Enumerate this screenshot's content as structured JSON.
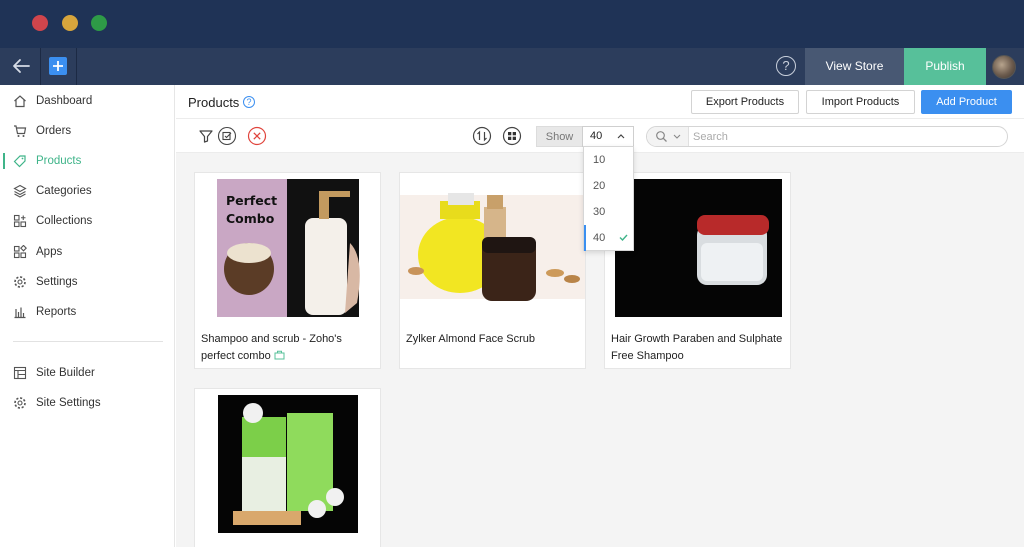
{
  "app": {
    "view_store_label": "View Store",
    "publish_label": "Publish",
    "help_glyph": "?",
    "accent_color": "#3fb489",
    "primary_color": "#3b8ff0"
  },
  "sidebar": {
    "items": [
      {
        "label": "Dashboard",
        "icon": "home-icon"
      },
      {
        "label": "Orders",
        "icon": "cart-icon"
      },
      {
        "label": "Products",
        "icon": "tag-icon",
        "active": true
      },
      {
        "label": "Categories",
        "icon": "layers-icon"
      },
      {
        "label": "Collections",
        "icon": "grid-plus-icon"
      },
      {
        "label": "Apps",
        "icon": "apps-icon"
      },
      {
        "label": "Settings",
        "icon": "gear-icon"
      },
      {
        "label": "Reports",
        "icon": "bar-chart-icon"
      }
    ],
    "bottom_items": [
      {
        "label": "Site Builder",
        "icon": "layout-icon"
      },
      {
        "label": "Site Settings",
        "icon": "gear-icon"
      }
    ]
  },
  "header": {
    "title": "Products",
    "help_glyph": "?",
    "export_label": "Export Products",
    "import_label": "Import Products",
    "add_label": "Add Product"
  },
  "toolbar": {
    "show_label": "Show",
    "show_value": "40",
    "search_placeholder": "Search"
  },
  "page_size_dropdown": {
    "options": [
      "10",
      "20",
      "30",
      "40"
    ],
    "selected": "40"
  },
  "products": [
    {
      "name": "Shampoo and scrub - Zoho's perfect combo",
      "image_text": [
        "Perfect",
        "Combo"
      ],
      "has_bundle_icon": true
    },
    {
      "name": "Zylker Almond Face Scrub"
    },
    {
      "name": "Hair Growth Paraben and Sulphate Free Shampoo"
    },
    {
      "name": ""
    }
  ]
}
